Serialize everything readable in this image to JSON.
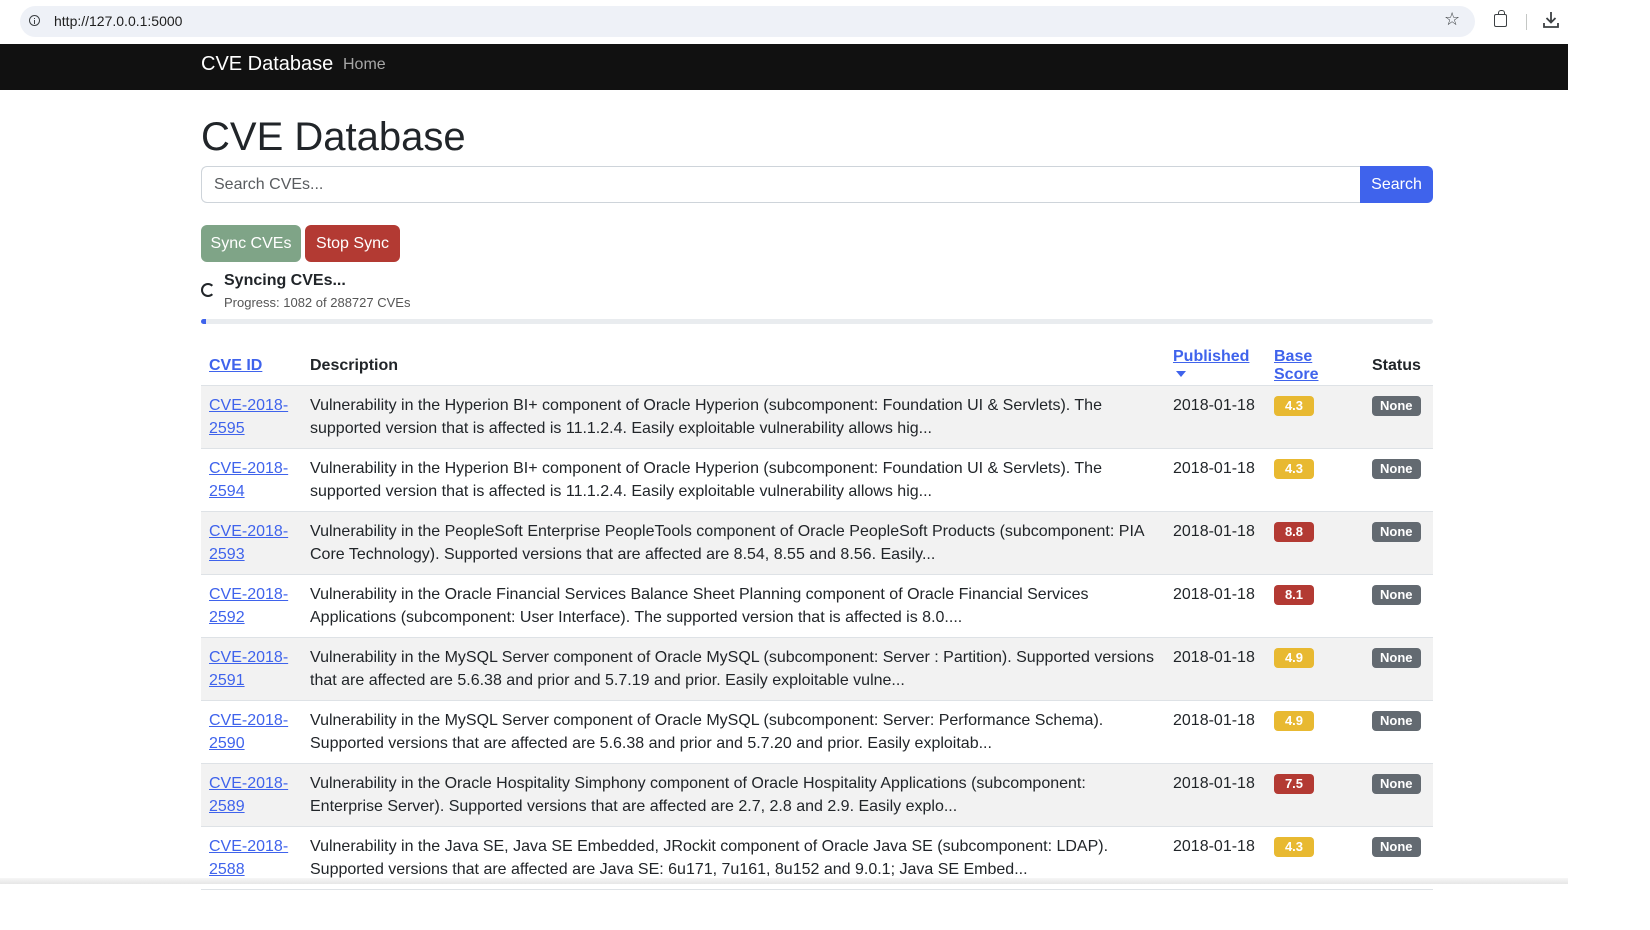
{
  "browser": {
    "url": "http://127.0.0.1:5000"
  },
  "navbar": {
    "brand": "CVE Database",
    "home": "Home"
  },
  "page": {
    "title": "CVE Database"
  },
  "search": {
    "placeholder": "Search CVEs...",
    "button": "Search"
  },
  "actions": {
    "sync": "Sync CVEs",
    "stop": "Stop Sync"
  },
  "sync_status": {
    "title": "Syncing CVEs...",
    "progress_text": "Progress: 1082 of 288727 CVEs",
    "done": 1082,
    "total": 288727
  },
  "colors": {
    "accent": "#3f63ec",
    "sync_button": "#7fa487",
    "stop_button": "#b33a33",
    "score_medium": "#e8b931",
    "score_high": "#b33a33",
    "status_badge": "#636a71"
  },
  "table": {
    "headers": {
      "cve_id": "CVE ID",
      "description": "Description",
      "published": "Published",
      "base_score": "Base Score",
      "status": "Status"
    },
    "sorted_by": "published",
    "sort_direction": "descending",
    "rows": [
      {
        "id_line1": "CVE-2018-",
        "id_line2": "2595",
        "description": "Vulnerability in the Hyperion BI+ component of Oracle Hyperion (subcomponent: Foundation UI & Servlets). The supported version that is affected is 11.1.2.4. Easily exploitable vulnerability allows hig...",
        "published": "2018-01-18",
        "score": "4.3",
        "severity": "medium",
        "status": "None"
      },
      {
        "id_line1": "CVE-2018-",
        "id_line2": "2594",
        "description": "Vulnerability in the Hyperion BI+ component of Oracle Hyperion (subcomponent: Foundation UI & Servlets). The supported version that is affected is 11.1.2.4. Easily exploitable vulnerability allows hig...",
        "published": "2018-01-18",
        "score": "4.3",
        "severity": "medium",
        "status": "None"
      },
      {
        "id_line1": "CVE-2018-",
        "id_line2": "2593",
        "description": "Vulnerability in the PeopleSoft Enterprise PeopleTools component of Oracle PeopleSoft Products (subcomponent: PIA Core Technology). Supported versions that are affected are 8.54, 8.55 and 8.56. Easily...",
        "published": "2018-01-18",
        "score": "8.8",
        "severity": "high",
        "status": "None"
      },
      {
        "id_line1": "CVE-2018-",
        "id_line2": "2592",
        "description": "Vulnerability in the Oracle Financial Services Balance Sheet Planning component of Oracle Financial Services Applications (subcomponent: User Interface). The supported version that is affected is 8.0....",
        "published": "2018-01-18",
        "score": "8.1",
        "severity": "high",
        "status": "None"
      },
      {
        "id_line1": "CVE-2018-",
        "id_line2": "2591",
        "description": "Vulnerability in the MySQL Server component of Oracle MySQL (subcomponent: Server : Partition). Supported versions that are affected are 5.6.38 and prior and 5.7.19 and prior. Easily exploitable vulne...",
        "published": "2018-01-18",
        "score": "4.9",
        "severity": "medium",
        "status": "None"
      },
      {
        "id_line1": "CVE-2018-",
        "id_line2": "2590",
        "description": "Vulnerability in the MySQL Server component of Oracle MySQL (subcomponent: Server: Performance Schema). Supported versions that are affected are 5.6.38 and prior and 5.7.20 and prior. Easily exploitab...",
        "published": "2018-01-18",
        "score": "4.9",
        "severity": "medium",
        "status": "None"
      },
      {
        "id_line1": "CVE-2018-",
        "id_line2": "2589",
        "description": "Vulnerability in the Oracle Hospitality Simphony component of Oracle Hospitality Applications (subcomponent: Enterprise Server). Supported versions that are affected are 2.7, 2.8 and 2.9. Easily explo...",
        "published": "2018-01-18",
        "score": "7.5",
        "severity": "high",
        "status": "None"
      },
      {
        "id_line1": "CVE-2018-",
        "id_line2": "2588",
        "description": "Vulnerability in the Java SE, Java SE Embedded, JRockit component of Oracle Java SE (subcomponent: LDAP). Supported versions that are affected are Java SE: 6u171, 7u161, 8u152 and 9.0.1; Java SE Embed...",
        "published": "2018-01-18",
        "score": "4.3",
        "severity": "medium",
        "status": "None"
      }
    ]
  }
}
